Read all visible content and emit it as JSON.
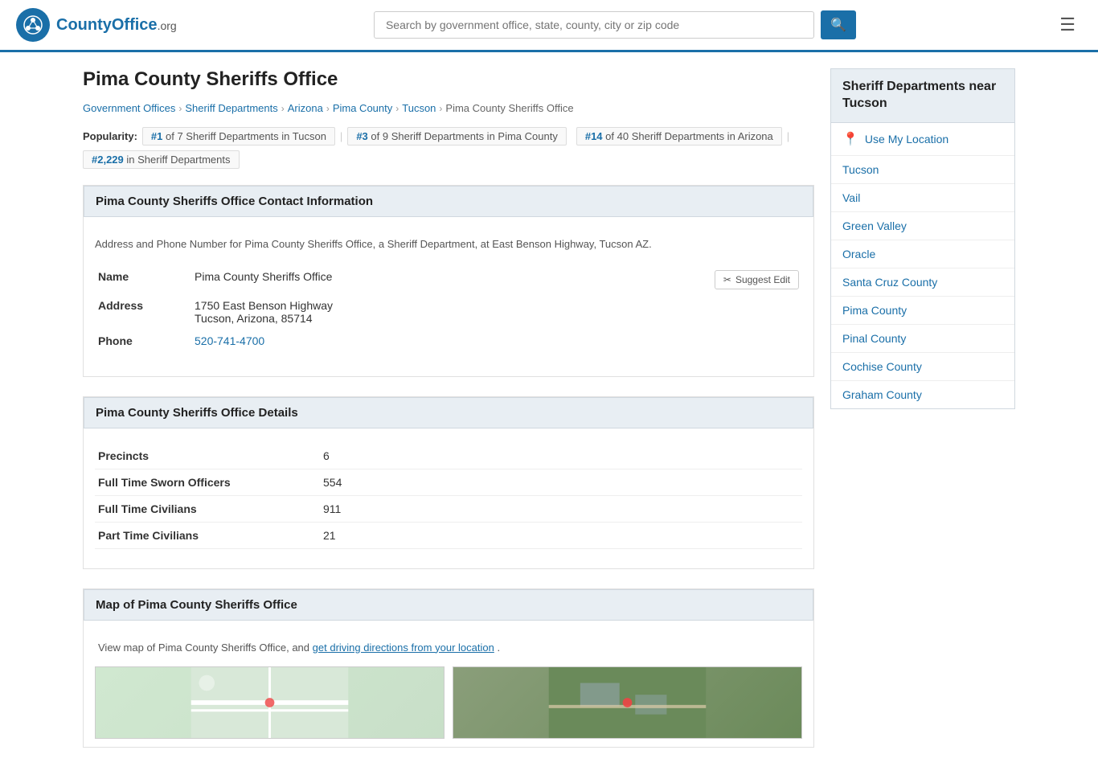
{
  "header": {
    "logo_text": "CountyOffice",
    "logo_org": ".org",
    "search_placeholder": "Search by government office, state, county, city or zip code",
    "search_button_icon": "🔍"
  },
  "page": {
    "title": "Pima County Sheriffs Office",
    "breadcrumb": [
      {
        "label": "Government Offices",
        "href": "#"
      },
      {
        "label": "Sheriff Departments",
        "href": "#"
      },
      {
        "label": "Arizona",
        "href": "#"
      },
      {
        "label": "Pima County",
        "href": "#"
      },
      {
        "label": "Tucson",
        "href": "#"
      },
      {
        "label": "Pima County Sheriffs Office",
        "href": "#"
      }
    ],
    "popularity": {
      "label": "Popularity:",
      "items": [
        {
          "text": "#1 of 7 Sheriff Departments in Tucson"
        },
        {
          "text": "#3 of 9 Sheriff Departments in Pima County"
        },
        {
          "text": "#14 of 40 Sheriff Departments in Arizona"
        },
        {
          "text": "#2,229 in Sheriff Departments"
        }
      ]
    }
  },
  "contact_section": {
    "header": "Pima County Sheriffs Office Contact Information",
    "description": "Address and Phone Number for Pima County Sheriffs Office, a Sheriff Department, at East Benson Highway, Tucson AZ.",
    "name_label": "Name",
    "name_value": "Pima County Sheriffs Office",
    "address_label": "Address",
    "address_line1": "1750 East Benson Highway",
    "address_line2": "Tucson, Arizona, 85714",
    "phone_label": "Phone",
    "phone_value": "520-741-4700",
    "suggest_edit_label": "Suggest Edit"
  },
  "details_section": {
    "header": "Pima County Sheriffs Office Details",
    "rows": [
      {
        "label": "Precincts",
        "value": "6"
      },
      {
        "label": "Full Time Sworn Officers",
        "value": "554"
      },
      {
        "label": "Full Time Civilians",
        "value": "911"
      },
      {
        "label": "Part Time Civilians",
        "value": "21"
      }
    ]
  },
  "map_section": {
    "header": "Map of Pima County Sheriffs Office",
    "description": "View map of Pima County Sheriffs Office, and",
    "driving_directions_link": "get driving directions from your location",
    "period": "."
  },
  "sidebar": {
    "header": "Sheriff Departments near Tucson",
    "use_location_label": "Use My Location",
    "links": [
      {
        "label": "Tucson",
        "href": "#"
      },
      {
        "label": "Vail",
        "href": "#"
      },
      {
        "label": "Green Valley",
        "href": "#"
      },
      {
        "label": "Oracle",
        "href": "#"
      },
      {
        "label": "Santa Cruz County",
        "href": "#"
      },
      {
        "label": "Pima County",
        "href": "#"
      },
      {
        "label": "Pinal County",
        "href": "#"
      },
      {
        "label": "Cochise County",
        "href": "#"
      },
      {
        "label": "Graham County",
        "href": "#"
      }
    ]
  }
}
